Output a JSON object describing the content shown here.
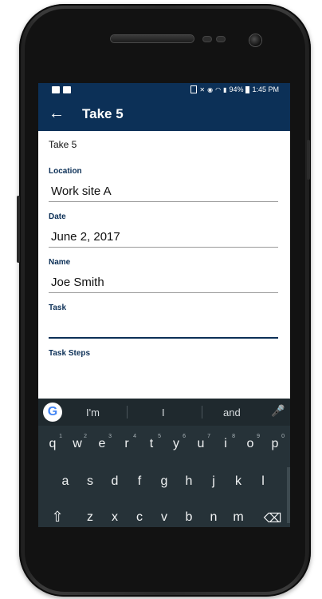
{
  "status_bar": {
    "battery": "94%",
    "time": "1:45 PM"
  },
  "app_bar": {
    "title": "Take 5"
  },
  "form": {
    "heading": "Take 5",
    "location_label": "Location",
    "location_value": "Work site A",
    "date_label": "Date",
    "date_value": "June 2, 2017",
    "name_label": "Name",
    "name_value": "Joe Smith",
    "task_label": "Task",
    "task_value": "",
    "task_steps_label": "Task Steps"
  },
  "keyboard": {
    "suggestions": [
      "I'm",
      "I",
      "and"
    ],
    "row1": [
      "q",
      "w",
      "e",
      "r",
      "t",
      "y",
      "u",
      "i",
      "o",
      "p"
    ],
    "row1_hints": [
      "1",
      "2",
      "3",
      "4",
      "5",
      "6",
      "7",
      "8",
      "9",
      "0"
    ],
    "row2": [
      "a",
      "s",
      "d",
      "f",
      "g",
      "h",
      "j",
      "k",
      "l"
    ],
    "row3": [
      "z",
      "x",
      "c",
      "v",
      "b",
      "n",
      "m"
    ]
  },
  "colors": {
    "primary": "#0c3057",
    "keyboard_bg": "#263238"
  },
  "icons": [
    "back-arrow-icon",
    "google-icon",
    "mic-icon",
    "shift-icon",
    "backspace-icon",
    "battery-icon",
    "wifi-icon",
    "signal-icon"
  ]
}
